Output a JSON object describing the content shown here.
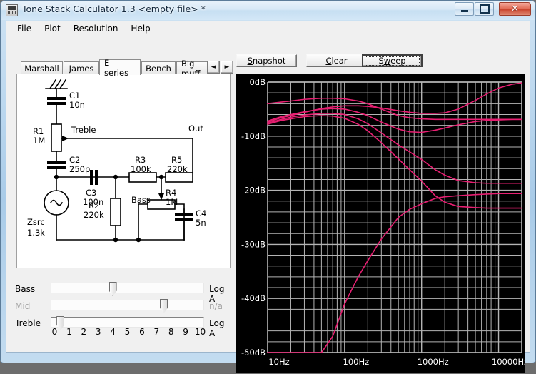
{
  "window": {
    "title": "Tone Stack Calculator 1.3 <empty file> *",
    "icon": "app-icon",
    "buttons": {
      "minimize": "minimize-icon",
      "maximize": "maximize-icon",
      "close": "✕"
    }
  },
  "menu": {
    "items": [
      {
        "label": "File"
      },
      {
        "label": "Plot"
      },
      {
        "label": "Resolution"
      },
      {
        "label": "Help"
      }
    ]
  },
  "toolbar": {
    "snapshot": {
      "pre": "",
      "mnemonic": "S",
      "post": "napshot"
    },
    "clear": {
      "pre": "",
      "mnemonic": "C",
      "post": "lear"
    },
    "sweep": {
      "pre": "S",
      "mnemonic": "w",
      "post": "eep"
    }
  },
  "tabs": {
    "items": [
      {
        "label": "Marshall",
        "active": false
      },
      {
        "label": "James",
        "active": false
      },
      {
        "label": "E series",
        "active": true
      },
      {
        "label": "Bench",
        "active": false
      },
      {
        "label": "Big muff",
        "active": false
      }
    ],
    "scroll_left": "◄",
    "scroll_right": "►"
  },
  "schematic": {
    "input_node": "antenna-input",
    "output_label": "Out",
    "source": {
      "name": "Zsrc",
      "value": "1.3k"
    },
    "components": [
      {
        "ref": "C1",
        "value": "10n",
        "type": "capacitor"
      },
      {
        "ref": "R1",
        "value": "1M",
        "type": "potentiometer",
        "tap": "Treble"
      },
      {
        "ref": "C2",
        "value": "250p",
        "type": "capacitor"
      },
      {
        "ref": "C3",
        "value": "100n",
        "type": "capacitor"
      },
      {
        "ref": "R2",
        "value": "220k",
        "type": "resistor"
      },
      {
        "ref": "R3",
        "value": "100k",
        "type": "resistor"
      },
      {
        "ref": "R5",
        "value": "220k",
        "type": "resistor"
      },
      {
        "ref": "R4",
        "value": "1M",
        "type": "potentiometer",
        "tap": "Bass"
      },
      {
        "ref": "C4",
        "value": "5n",
        "type": "capacitor"
      }
    ],
    "tap_labels": [
      "Treble",
      "Bass"
    ]
  },
  "sliders": {
    "rows": [
      {
        "label": "Bass",
        "value": 4.0,
        "taper": "Log A",
        "disabled": false
      },
      {
        "label": "Mid",
        "value": 7.5,
        "taper": "n/a",
        "disabled": true
      },
      {
        "label": "Treble",
        "value": 0.4,
        "taper": "Log A",
        "disabled": false
      }
    ],
    "scale": [
      "0",
      "1",
      "2",
      "3",
      "4",
      "5",
      "6",
      "7",
      "8",
      "9",
      "10"
    ],
    "min": 0,
    "max": 10
  },
  "graph": {
    "background_color": "#000000",
    "grid_color": "#b4b4b4",
    "curve_color": "#e81f72",
    "axis_text_color": "#ffffff"
  },
  "chart_data": {
    "type": "line",
    "title": "",
    "xlabel": "",
    "ylabel": "",
    "xscale": "log",
    "xlim": [
      10,
      20000
    ],
    "ylim": [
      -50,
      0
    ],
    "xtick_labels": [
      "10Hz",
      "100Hz",
      "1000Hz",
      "10000Hz"
    ],
    "xticks": [
      10,
      100,
      1000,
      10000
    ],
    "ytick_labels": [
      "0dB",
      "-10dB",
      "-20dB",
      "-30dB",
      "-40dB",
      "-50dB"
    ],
    "yticks": [
      0,
      -10,
      -20,
      -30,
      -40,
      -50
    ],
    "grid": true,
    "grid_minor_y_step": 2,
    "legend": "none",
    "x": [
      10,
      15,
      20,
      30,
      50,
      70,
      100,
      150,
      200,
      300,
      500,
      700,
      1000,
      1500,
      2000,
      3000,
      5000,
      7000,
      10000,
      15000,
      20000
    ],
    "series": [
      {
        "name": "curve-1",
        "values": [
          -7.4,
          -6.6,
          -6.2,
          -5.6,
          -4.9,
          -4.6,
          -4.4,
          -4.4,
          -4.5,
          -4.8,
          -5.3,
          -5.6,
          -5.8,
          -5.8,
          -5.7,
          -5.0,
          -3.4,
          -2.2,
          -1.1,
          -0.4,
          -0.15
        ]
      },
      {
        "name": "curve-2",
        "values": [
          -4.0,
          -3.7,
          -3.5,
          -3.2,
          -3.0,
          -3.0,
          -3.1,
          -3.5,
          -4.0,
          -5.0,
          -6.2,
          -6.6,
          -6.8,
          -6.9,
          -6.9,
          -6.9,
          -6.9,
          -6.9,
          -6.9,
          -6.9,
          -6.9
        ]
      },
      {
        "name": "curve-3",
        "values": [
          -7.2,
          -6.4,
          -6.0,
          -5.5,
          -5.0,
          -4.9,
          -5.0,
          -5.6,
          -6.2,
          -7.4,
          -8.7,
          -9.2,
          -9.3,
          -8.9,
          -8.5,
          -7.9,
          -7.3,
          -7.1,
          -7.0,
          -6.9,
          -6.9
        ]
      },
      {
        "name": "curve-4",
        "values": [
          -7.6,
          -6.9,
          -6.5,
          -6.1,
          -5.8,
          -5.8,
          -6.0,
          -6.8,
          -7.7,
          -9.4,
          -11.6,
          -12.9,
          -14.3,
          -16.2,
          -17.2,
          -18.2,
          -18.6,
          -18.7,
          -18.7,
          -18.7,
          -18.7
        ]
      },
      {
        "name": "curve-5",
        "values": [
          -7.8,
          -7.1,
          -6.8,
          -6.4,
          -6.2,
          -6.3,
          -6.7,
          -7.8,
          -9.0,
          -11.2,
          -14.2,
          -16.2,
          -18.3,
          -21.0,
          -22.2,
          -23.0,
          -23.2,
          -23.3,
          -23.3,
          -23.3,
          -23.3
        ]
      },
      {
        "name": "curve-6",
        "values": [
          -50,
          -50,
          -50,
          -50,
          -50,
          -47,
          -41,
          -36,
          -33,
          -29,
          -25,
          -23.5,
          -22.5,
          -21.5,
          -21.2,
          -21.0,
          -20.8,
          -20.7,
          -20.6,
          -20.6,
          -20.6
        ]
      }
    ]
  }
}
